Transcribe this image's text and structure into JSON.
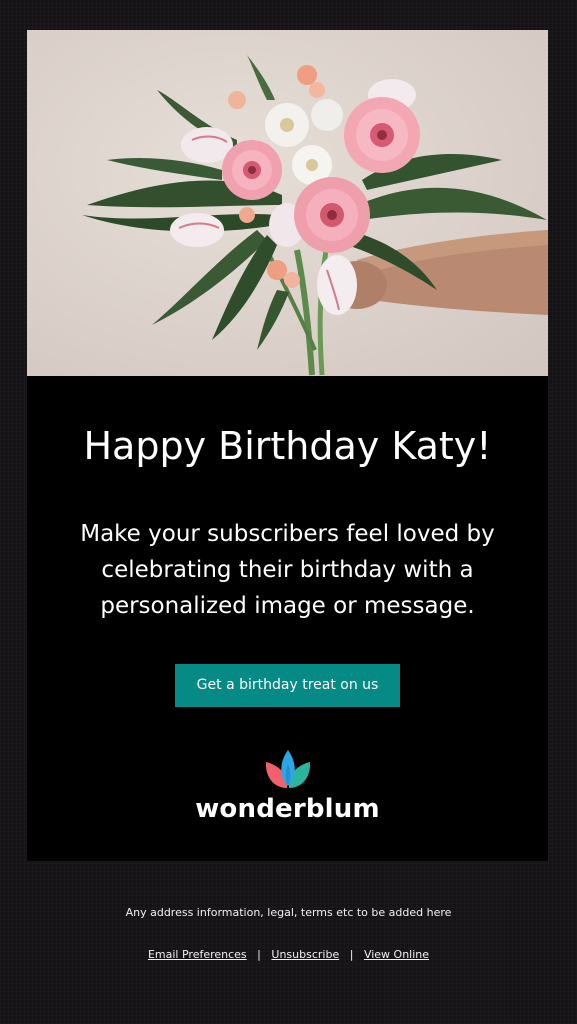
{
  "hero": {
    "image_alt": "hand holding a bouquet of pink gerberas and white tulips"
  },
  "email": {
    "headline": "Happy Birthday Katy!",
    "body_text": "Make your subscribers feel loved by celebrating their birthday with a personalized image or message.",
    "cta_label": "Get a birthday treat on us"
  },
  "brand": {
    "name": "wonderblum",
    "colors": {
      "petal_left": "#f2606b",
      "petal_center": "#2ba7e3",
      "petal_right": "#2bb59d"
    }
  },
  "footer": {
    "note": "Any address information, legal, terms etc to be added here",
    "links": [
      {
        "label": "Email Preferences"
      },
      {
        "label": "Unsubscribe"
      },
      {
        "label": "View Online"
      }
    ],
    "separator": "|"
  },
  "colors": {
    "page_background": "#151316",
    "card_background": "#000000",
    "cta_background": "#058a86",
    "text": "#ffffff"
  }
}
